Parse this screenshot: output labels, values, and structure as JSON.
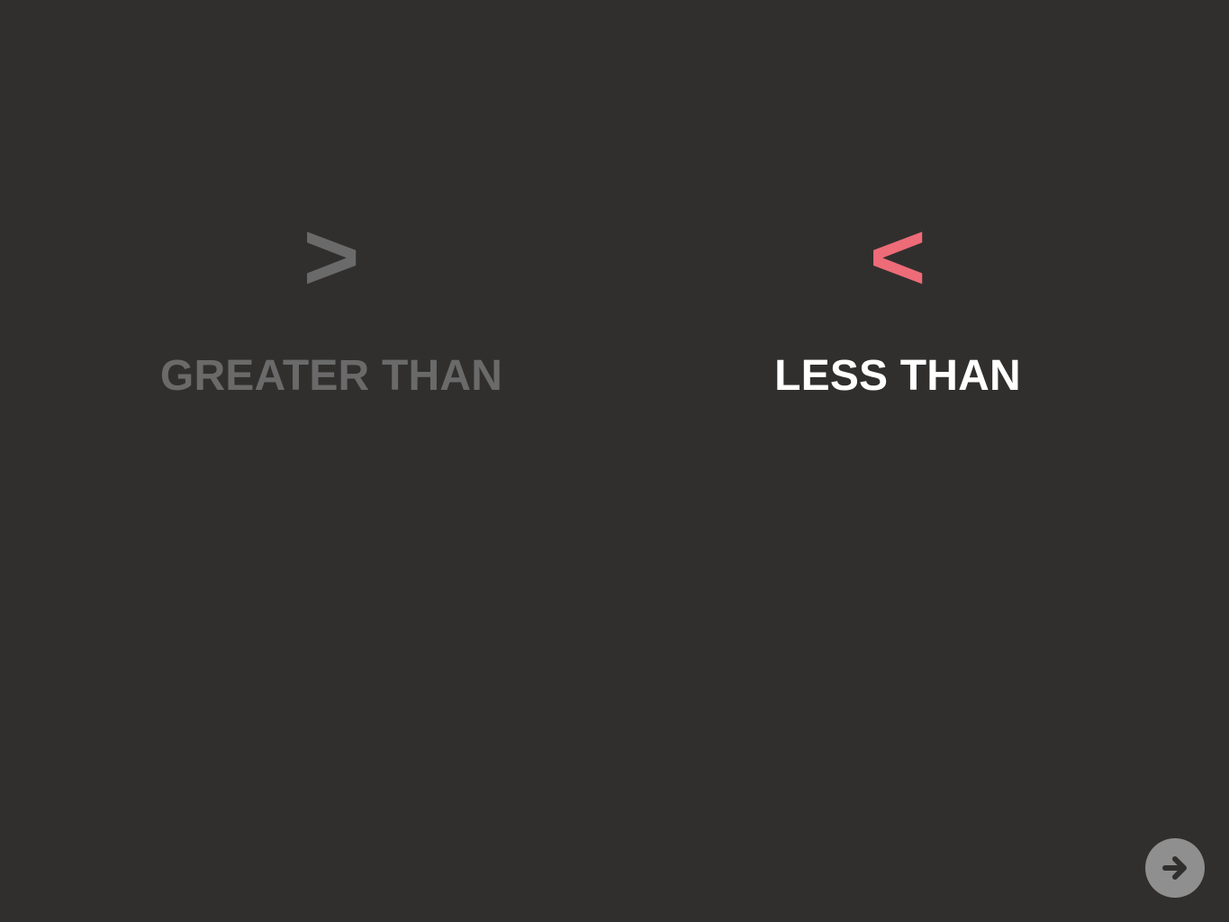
{
  "options": [
    {
      "symbol": ">",
      "label": "GREATER THAN",
      "state": "dimmed",
      "symbol_color": "#6a6a6a",
      "label_color": "#6a6a6a"
    },
    {
      "symbol": "<",
      "label": "LESS THAN",
      "state": "selected",
      "symbol_color": "#ee6b78",
      "label_color": "#ffffff"
    }
  ],
  "navigation": {
    "next_icon": "arrow-right-icon",
    "button_color": "#8f8f8f",
    "icon_color": "#312f2e"
  },
  "theme": {
    "background": "#312f2e"
  }
}
